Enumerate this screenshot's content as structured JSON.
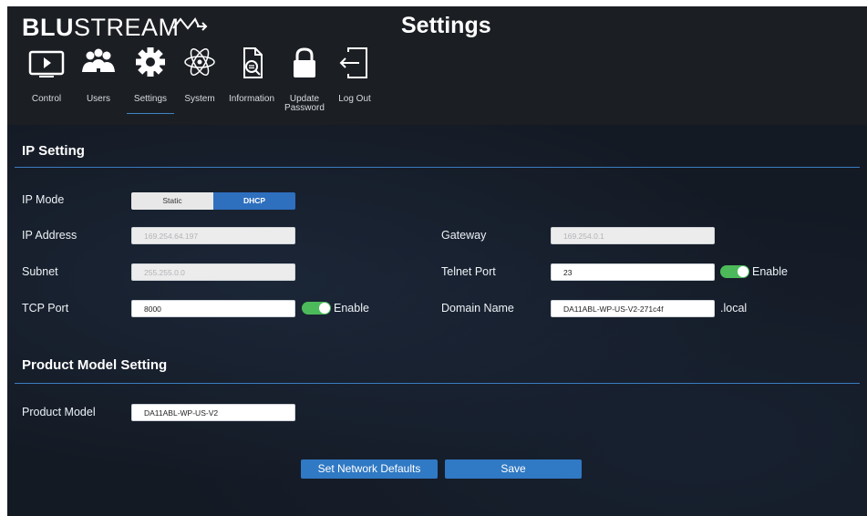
{
  "header": {
    "logo_bold": "BLU",
    "logo_rest": "STREAM",
    "title": "Settings"
  },
  "nav": {
    "items": [
      {
        "label": "Control",
        "icon": "monitor-play-icon"
      },
      {
        "label": "Users",
        "icon": "users-icon"
      },
      {
        "label": "Settings",
        "icon": "gear-icon",
        "active": true
      },
      {
        "label": "System",
        "icon": "atom-icon"
      },
      {
        "label": "Information",
        "icon": "document-search-icon"
      },
      {
        "label_line1": "Update",
        "label_line2": "Password",
        "icon": "lock-icon"
      },
      {
        "label": "Log Out",
        "icon": "logout-icon"
      }
    ]
  },
  "ip_setting": {
    "title": "IP Setting",
    "ip_mode_label": "IP Mode",
    "ip_mode_options": [
      "Static",
      "DHCP"
    ],
    "ip_mode_selected": "DHCP",
    "ip_address_label": "IP Address",
    "ip_address_value": "169.254.64.197",
    "gateway_label": "Gateway",
    "gateway_value": "169.254.0.1",
    "subnet_label": "Subnet",
    "subnet_value": "255.255.0.0",
    "telnet_port_label": "Telnet Port",
    "telnet_port_value": "23",
    "telnet_enable_label": "Enable",
    "tcp_port_label": "TCP Port",
    "tcp_port_value": "8000",
    "tcp_enable_label": "Enable",
    "domain_name_label": "Domain Name",
    "domain_name_value": "DA11ABL-WP-US-V2-271c4f",
    "domain_suffix": ".local"
  },
  "product_model_setting": {
    "title": "Product Model Setting",
    "product_model_label": "Product Model",
    "product_model_value": "DA11ABL-WP-US-V2"
  },
  "actions": {
    "set_network_defaults": "Set Network Defaults",
    "save": "Save"
  },
  "colors": {
    "accent": "#3079c4",
    "toggle_on": "#4cba5a",
    "background": "#141a24"
  }
}
